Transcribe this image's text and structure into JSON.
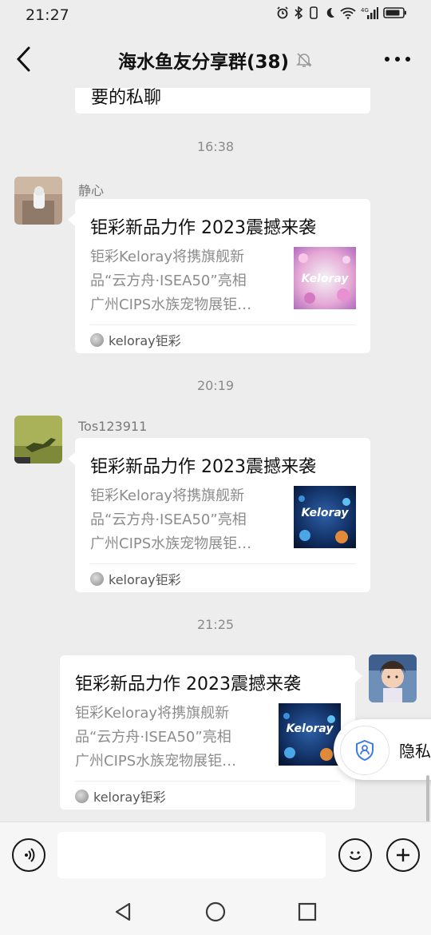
{
  "status_bar": {
    "time": "21:27",
    "network_label": "4G"
  },
  "header": {
    "title": "海水鱼友分享群(38)"
  },
  "messages": [
    {
      "type": "text_fragment",
      "text": "要的私聊"
    },
    {
      "type": "timestamp",
      "text": "16:38"
    },
    {
      "type": "card",
      "side": "left",
      "sender": "静心",
      "avatar": "photo-avatar",
      "title": "钜彩新品力作 2023震撼来袭",
      "desc": [
        "钜彩Keloray将携旗舰新",
        "品“云方舟·ISEA50”亮相",
        "广州CIPS水族宠物展钜…"
      ],
      "thumb_text": "Keloray",
      "thumb_style": "pink",
      "source": "keloray钜彩"
    },
    {
      "type": "timestamp",
      "text": "20:19"
    },
    {
      "type": "card",
      "side": "left",
      "sender": "Tos123911",
      "avatar": "lizard-avatar",
      "title": "钜彩新品力作 2023震撼来袭",
      "desc": [
        "钜彩Keloray将携旗舰新",
        "品“云方舟·ISEA50”亮相",
        "广州CIPS水族宠物展钜…"
      ],
      "thumb_text": "Keloray",
      "thumb_style": "blue",
      "source": "keloray钜彩"
    },
    {
      "type": "timestamp",
      "text": "21:25"
    },
    {
      "type": "card",
      "side": "right",
      "avatar": "child-avatar",
      "title": "钜彩新品力作 2023震撼来袭",
      "desc": [
        "钜彩Keloray将携旗舰新",
        "品“云方舟·ISEA50”亮相",
        "广州CIPS水族宠物展钜…"
      ],
      "thumb_text": "Keloray",
      "thumb_style": "blue",
      "source": "keloray钜彩"
    }
  ],
  "privacy_popup": {
    "label": "隐私",
    "icon": "shield-person-icon"
  },
  "input_bar": {
    "placeholder": "",
    "left_icon": "voice-icon",
    "emoji_icon": "emoji-icon",
    "plus_icon": "plus-icon"
  },
  "system_nav": {
    "back": "back-triangle-icon",
    "home": "home-circle-icon",
    "recents": "recents-square-icon"
  },
  "colors": {
    "background": "#ededed",
    "card": "#ffffff",
    "timestamp": "#8a8a8a",
    "desc": "#8c8c8c"
  }
}
